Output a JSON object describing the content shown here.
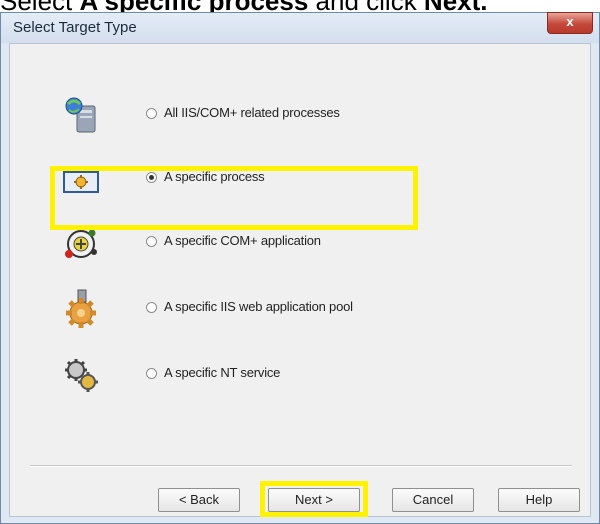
{
  "top_caption": {
    "prefix": "Select ",
    "bold": "A specific process",
    "middle": " and click ",
    "bold2": "Next."
  },
  "dialog": {
    "title": "Select Target Type",
    "close_label": "x"
  },
  "options": [
    {
      "label": "All IIS/COM+ related processes",
      "icon": "iis-com-processes-icon",
      "selected": false
    },
    {
      "label": "A specific process",
      "icon": "process-window-icon",
      "selected": true
    },
    {
      "label": "A specific COM+ application",
      "icon": "com-application-icon",
      "selected": false
    },
    {
      "label": "A specific IIS web application pool",
      "icon": "app-pool-gear-icon",
      "selected": false
    },
    {
      "label": "A specific NT service",
      "icon": "nt-service-gears-icon",
      "selected": false
    }
  ],
  "buttons": {
    "back": "< Back",
    "next": "Next >",
    "cancel": "Cancel",
    "help": "Help"
  },
  "colors": {
    "highlight": "#fff200",
    "close_button": "#c4493a"
  }
}
